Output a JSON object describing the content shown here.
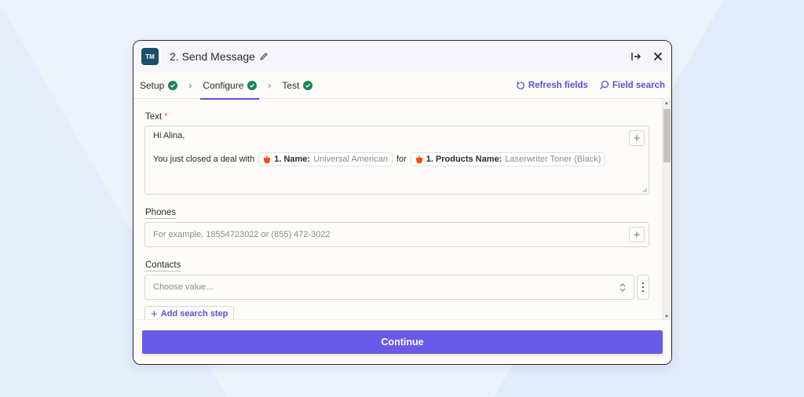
{
  "header": {
    "app_logo_text": "TM",
    "title": "2. Send Message",
    "icons": [
      "pencil-icon",
      "collapse-panel-icon",
      "close-icon"
    ]
  },
  "tabs": [
    {
      "label": "Setup",
      "status": "complete"
    },
    {
      "label": "Configure",
      "status": "complete",
      "active": true
    },
    {
      "label": "Test",
      "status": "complete"
    }
  ],
  "tab_actions": {
    "refresh_label": "Refresh fields",
    "search_label": "Field search"
  },
  "fields": {
    "text": {
      "label": "Text",
      "required_marker": "*",
      "line1": "Hi Alina,",
      "line2_prefix": "You just closed a deal with",
      "pill1_key": "1. Name:",
      "pill1_value": "Universal American",
      "connector": "for",
      "pill2_key": "1. Products Name:",
      "pill2_value": "Laserwriter Toner (Black)"
    },
    "phones": {
      "label": "Phones",
      "placeholder": "For example, 18554723022 or (855) 472-3022"
    },
    "contacts": {
      "label": "Contacts",
      "placeholder": "Choose value...",
      "add_search_step_label": "Add search step"
    }
  },
  "footer": {
    "continue_label": "Continue"
  },
  "colors": {
    "accent": "#695be8",
    "link": "#5b4fe0",
    "success": "#16884d",
    "required": "#e8622a",
    "pill_icon": "#ff4f00"
  }
}
